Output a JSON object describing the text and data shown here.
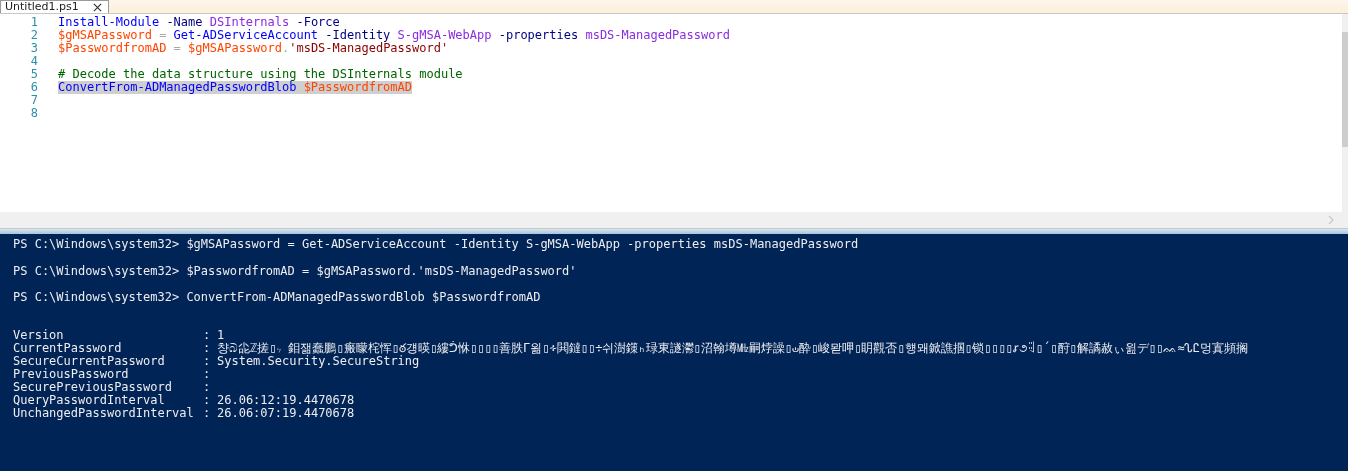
{
  "tabs": [
    {
      "label": "Untitled1.ps1",
      "selected": true
    }
  ],
  "editor": {
    "lines": [
      {
        "number": "1",
        "selected": false,
        "tokens": [
          {
            "text": "Install-Module",
            "kind": "command"
          },
          {
            "text": " -Name",
            "kind": "parameter"
          },
          {
            "text": " DSInternals",
            "kind": "argument"
          },
          {
            "text": " -Force",
            "kind": "parameter"
          }
        ]
      },
      {
        "number": "2",
        "selected": false,
        "tokens": [
          {
            "text": "$gMSAPassword",
            "kind": "variable"
          },
          {
            "text": " =",
            "kind": "operator"
          },
          {
            "text": " Get-ADServiceAccount",
            "kind": "command"
          },
          {
            "text": " -Identity",
            "kind": "parameter"
          },
          {
            "text": " S-gMSA-WebApp",
            "kind": "argument"
          },
          {
            "text": " -properties",
            "kind": "parameter"
          },
          {
            "text": " msDS-ManagedPassword",
            "kind": "argument"
          }
        ]
      },
      {
        "number": "3",
        "selected": false,
        "tokens": [
          {
            "text": "$PasswordfromAD",
            "kind": "variable"
          },
          {
            "text": " =",
            "kind": "operator"
          },
          {
            "text": " $gMSAPassword",
            "kind": "variable"
          },
          {
            "text": ".",
            "kind": "operator"
          },
          {
            "text": "'msDS-ManagedPassword'",
            "kind": "string"
          }
        ]
      },
      {
        "number": "4",
        "selected": false
      },
      {
        "number": "5",
        "selected": false,
        "tokens": [
          {
            "text": "# Decode the data structure using the DSInternals module",
            "kind": "comment"
          }
        ]
      },
      {
        "number": "6",
        "selected": true,
        "tokens": [
          {
            "text": "ConvertFrom-ADManagedPasswordBlob",
            "kind": "command"
          },
          {
            "text": " $PasswordfromAD",
            "kind": "variable"
          }
        ]
      },
      {
        "number": "7",
        "selected": false
      },
      {
        "number": "8",
        "selected": false
      }
    ]
  },
  "console": {
    "commands": [
      {
        "prompt": "PS C:\\Windows\\system32>",
        "command": "$gMSAPassword = Get-ADServiceAccount -Identity S-gMSA-WebApp -properties msDS-ManagedPassword"
      },
      {
        "prompt": "PS C:\\Windows\\system32>",
        "command": "$PasswordfromAD = $gMSAPassword.'msDS-ManagedPassword'"
      },
      {
        "prompt": "PS C:\\Windows\\system32>",
        "command": "ConvertFrom-ADManagedPasswordBlob $PasswordfromAD"
      }
    ],
    "output": [
      {
        "name": "Version",
        "separator": ":",
        "value": "1"
      },
      {
        "name": "CurrentPassword",
        "separator": ":",
        "value": "챵බ㕾ℤ搓▯ㆴ鉬잶蠢鵬▯瘢矇㭦恽▯ఠ걩暎▯縷ᕥ恘▯▯▯▯善胅Γ욂▯∻閧鐽▯▯÷쉬澍鏼ₕ琭東譢灪▯沼翰墫㎒嗣㶿譟▯ഄ酔▯峻뫋呷▯眀觀否▯헁뫠鍁譙掴▯锁▯▯▯▯ꭉ૭ꂥ▯´▯酧▯解譎赦ぃ윒デ▯▯ᨐ≈ᔐᏝ멍寘頻搁"
      },
      {
        "name": "SecureCurrentPassword",
        "separator": ":",
        "value": "System.Security.SecureString"
      },
      {
        "name": "PreviousPassword",
        "separator": ":"
      },
      {
        "name": "SecurePreviousPassword",
        "separator": ":"
      },
      {
        "name": "QueryPasswordInterval",
        "separator": ":",
        "value": "26.06:12:19.4470678"
      },
      {
        "name": "UnchangedPasswordInterval",
        "separator": ":",
        "value": "26.06:07:19.4470678"
      }
    ]
  }
}
